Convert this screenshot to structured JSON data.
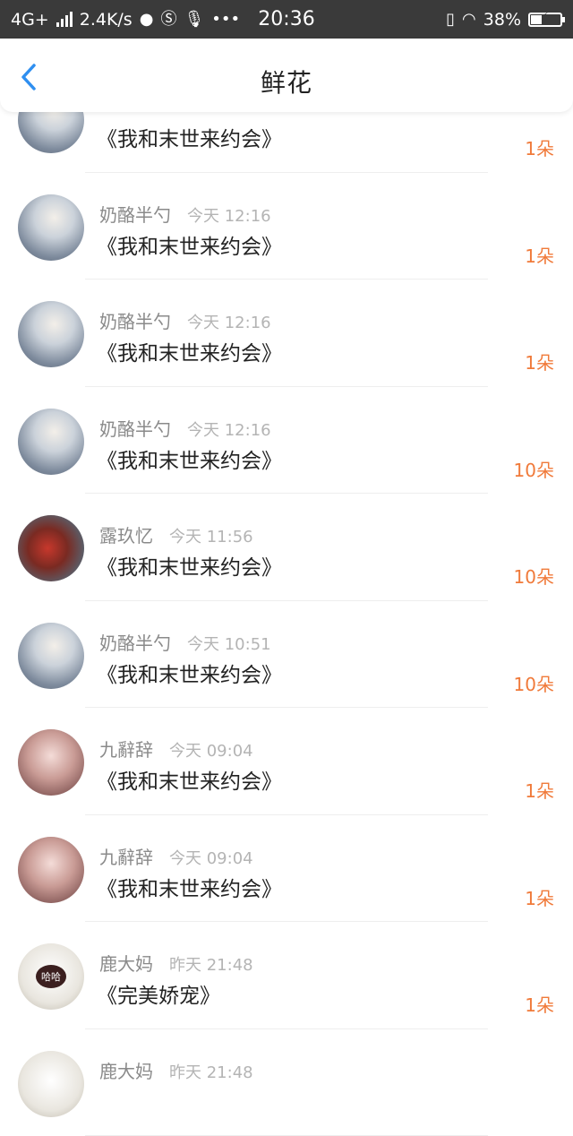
{
  "status_bar": {
    "network": "4G+",
    "speed": "2.4K/s",
    "time": "20:36",
    "battery": "38%",
    "battery_level": 0.38,
    "icons": [
      "signal-icon",
      "planet-icon",
      "s-app-icon",
      "mic-icon",
      "more-icon",
      "vibrate-icon",
      "wifi-icon",
      "battery-icon"
    ]
  },
  "header": {
    "title": "鲜花",
    "back_icon": "chevron-left-icon"
  },
  "colors": {
    "accent_blue": "#2f8ff0",
    "count_orange": "#f07a3a",
    "status_bar_bg": "#3a3a3a"
  },
  "items": [
    {
      "name": "",
      "time": "",
      "book": "《我和末世来约会》",
      "count": "1朵",
      "avatar": "silver"
    },
    {
      "name": "奶酪半勺",
      "time": "今天 12:16",
      "book": "《我和末世来约会》",
      "count": "1朵",
      "avatar": "silver"
    },
    {
      "name": "奶酪半勺",
      "time": "今天 12:16",
      "book": "《我和末世来约会》",
      "count": "1朵",
      "avatar": "silver"
    },
    {
      "name": "奶酪半勺",
      "time": "今天 12:16",
      "book": "《我和末世来约会》",
      "count": "10朵",
      "avatar": "silver"
    },
    {
      "name": "露玖忆",
      "time": "今天 11:56",
      "book": "《我和末世来约会》",
      "count": "10朵",
      "avatar": "red"
    },
    {
      "name": "奶酪半勺",
      "time": "今天 10:51",
      "book": "《我和末世来约会》",
      "count": "10朵",
      "avatar": "silver"
    },
    {
      "name": "九辭辞",
      "time": "今天 09:04",
      "book": "《我和末世来约会》",
      "count": "1朵",
      "avatar": "pink"
    },
    {
      "name": "九辭辞",
      "time": "今天 09:04",
      "book": "《我和末世来约会》",
      "count": "1朵",
      "avatar": "pink"
    },
    {
      "name": "鹿大妈",
      "time": "昨天 21:48",
      "book": "《完美娇宠》",
      "count": "1朵",
      "avatar": "dog",
      "avatar_text": "哈哈"
    },
    {
      "name": "鹿大妈",
      "time": "昨天 21:48",
      "book": "",
      "count": "",
      "avatar": "dog",
      "avatar_text": ""
    }
  ]
}
